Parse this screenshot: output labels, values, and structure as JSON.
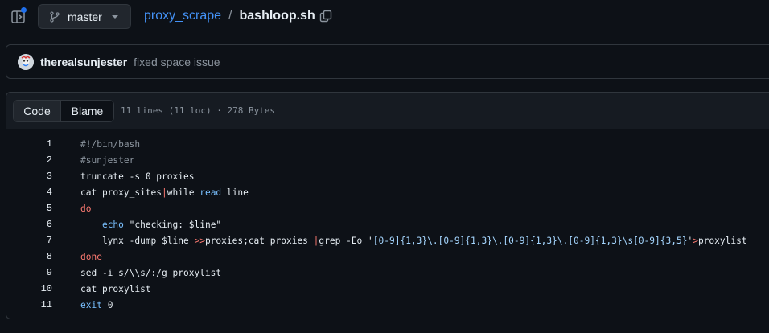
{
  "topbar": {
    "branch": "master",
    "repo": "proxy_scrape",
    "separator": "/",
    "file": "bashloop.sh"
  },
  "commit": {
    "author": "therealsunjester",
    "message": "fixed space issue"
  },
  "file_header": {
    "tab_code": "Code",
    "tab_blame": "Blame",
    "meta": "11 lines (11 loc) · 278 Bytes"
  },
  "code": {
    "lines": [
      {
        "n": "1",
        "tokens": [
          {
            "t": "#!/bin/bash",
            "c": "comment"
          }
        ]
      },
      {
        "n": "2",
        "tokens": [
          {
            "t": "#sunjester",
            "c": "comment"
          }
        ]
      },
      {
        "n": "3",
        "tokens": [
          {
            "t": "truncate -s 0 proxies",
            "c": "plain"
          }
        ]
      },
      {
        "n": "4",
        "tokens": [
          {
            "t": "cat proxy_sites",
            "c": "plain"
          },
          {
            "t": "|",
            "c": "op"
          },
          {
            "t": "while ",
            "c": "plain"
          },
          {
            "t": "read",
            "c": "builtin"
          },
          {
            "t": " line",
            "c": "plain"
          }
        ]
      },
      {
        "n": "5",
        "tokens": [
          {
            "t": "do",
            "c": "kw"
          }
        ]
      },
      {
        "n": "6",
        "tokens": [
          {
            "t": "    ",
            "c": "plain"
          },
          {
            "t": "echo",
            "c": "builtin"
          },
          {
            "t": " ",
            "c": "plain"
          },
          {
            "t": "\"checking: $line\"",
            "c": "plain"
          }
        ]
      },
      {
        "n": "7",
        "tokens": [
          {
            "t": "    lynx -dump $line ",
            "c": "plain"
          },
          {
            "t": ">>",
            "c": "op"
          },
          {
            "t": "proxies;cat proxies ",
            "c": "plain"
          },
          {
            "t": "|",
            "c": "op"
          },
          {
            "t": "grep -Eo ",
            "c": "plain"
          },
          {
            "t": "'",
            "c": "plain"
          },
          {
            "t": "[0-9]{1,3}\\.[0-9]{1,3}\\.[0-9]{1,3}\\.[0-9]{1,3}\\s[0-9]{3,5}",
            "c": "str"
          },
          {
            "t": "'",
            "c": "plain"
          },
          {
            "t": ">",
            "c": "op"
          },
          {
            "t": "proxylist",
            "c": "plain"
          }
        ]
      },
      {
        "n": "8",
        "tokens": [
          {
            "t": "done",
            "c": "kw"
          }
        ]
      },
      {
        "n": "9",
        "tokens": [
          {
            "t": "sed -i s/\\\\s/:/g proxylist",
            "c": "plain"
          }
        ]
      },
      {
        "n": "10",
        "tokens": [
          {
            "t": "cat proxylist",
            "c": "plain"
          }
        ]
      },
      {
        "n": "11",
        "tokens": [
          {
            "t": "exit",
            "c": "builtin"
          },
          {
            "t": " 0",
            "c": "plain"
          }
        ]
      }
    ]
  },
  "colors": {
    "background": "#0d1117",
    "link": "#4493f8",
    "keyword": "#ff7b72",
    "builtin": "#79c0ff",
    "comment": "#8b949e"
  }
}
